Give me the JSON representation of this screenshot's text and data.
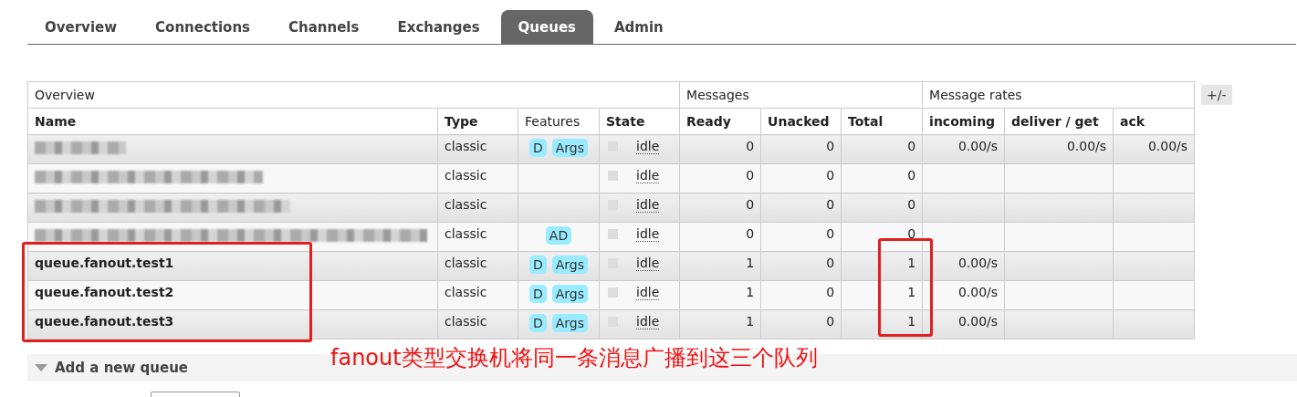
{
  "tabs": [
    {
      "label": "Overview",
      "selected": false
    },
    {
      "label": "Connections",
      "selected": false
    },
    {
      "label": "Channels",
      "selected": false
    },
    {
      "label": "Exchanges",
      "selected": false
    },
    {
      "label": "Queues",
      "selected": true
    },
    {
      "label": "Admin",
      "selected": false
    }
  ],
  "table": {
    "groups": [
      {
        "label": "Overview",
        "columns": [
          "Name",
          "Type",
          "Features",
          "State"
        ]
      },
      {
        "label": "Messages",
        "columns": [
          "Ready",
          "Unacked",
          "Total"
        ]
      },
      {
        "label": "Message rates",
        "columns": [
          "incoming",
          "deliver / get",
          "ack"
        ]
      }
    ],
    "toggle_button": "+/-",
    "rows": [
      {
        "redacted": true,
        "type": "classic",
        "features": [
          "D",
          "Args"
        ],
        "state": "idle",
        "ready": "0",
        "unacked": "0",
        "total": "0",
        "incoming": "0.00/s",
        "deliver_get": "0.00/s",
        "ack": "0.00/s"
      },
      {
        "redacted": true,
        "type": "classic",
        "features": [],
        "state": "idle",
        "ready": "0",
        "unacked": "0",
        "total": "0"
      },
      {
        "redacted": true,
        "type": "classic",
        "features": [],
        "state": "idle",
        "ready": "0",
        "unacked": "0",
        "total": "0"
      },
      {
        "redacted": true,
        "type": "classic",
        "features": [
          "AD"
        ],
        "state": "idle",
        "ready": "0",
        "unacked": "0",
        "total": "0"
      },
      {
        "name": "queue.fanout.test1",
        "redacted": false,
        "type": "classic",
        "features": [
          "D",
          "Args"
        ],
        "state": "idle",
        "ready": "1",
        "unacked": "0",
        "total": "1",
        "incoming": "0.00/s"
      },
      {
        "name": "queue.fanout.test2",
        "redacted": false,
        "type": "classic",
        "features": [
          "D",
          "Args"
        ],
        "state": "idle",
        "ready": "1",
        "unacked": "0",
        "total": "1",
        "incoming": "0.00/s"
      },
      {
        "name": "queue.fanout.test3",
        "redacted": false,
        "type": "classic",
        "features": [
          "D",
          "Args"
        ],
        "state": "idle",
        "ready": "1",
        "unacked": "0",
        "total": "1",
        "incoming": "0.00/s"
      }
    ]
  },
  "add_queue": {
    "label": "Add a new queue"
  },
  "annotation": {
    "text": "fanout类型交换机将同一条消息广播到这三个队列"
  }
}
